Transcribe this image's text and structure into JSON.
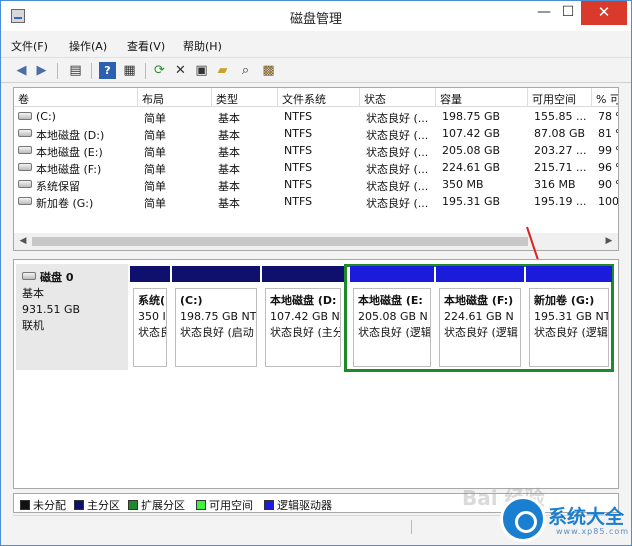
{
  "window": {
    "title": "磁盘管理",
    "controls": {
      "minimize": "—",
      "maximize": "☐",
      "close": "✕"
    }
  },
  "menu": [
    "文件(F)",
    "操作(A)",
    "查看(V)",
    "帮助(H)"
  ],
  "toolbar_icons": [
    "back-arrow-icon",
    "forward-arrow-icon",
    "console-tree-icon",
    "help-icon",
    "properties-icon",
    "refresh-icon",
    "delete-icon",
    "disk-properties-icon",
    "open-folder-icon",
    "search-icon",
    "settings-icon"
  ],
  "volumes": {
    "headers": [
      "卷",
      "布局",
      "类型",
      "文件系统",
      "状态",
      "容量",
      "可用空间",
      "% 可"
    ],
    "rows": [
      [
        "(C:)",
        "简单",
        "基本",
        "NTFS",
        "状态良好 (...",
        "198.75 GB",
        "155.85 ...",
        "78 %"
      ],
      [
        "本地磁盘 (D:)",
        "简单",
        "基本",
        "NTFS",
        "状态良好 (...",
        "107.42 GB",
        "87.08 GB",
        "81 %"
      ],
      [
        "本地磁盘 (E:)",
        "简单",
        "基本",
        "NTFS",
        "状态良好 (...",
        "205.08 GB",
        "203.27 ...",
        "99 %"
      ],
      [
        "本地磁盘 (F:)",
        "简单",
        "基本",
        "NTFS",
        "状态良好 (...",
        "224.61 GB",
        "215.71 ...",
        "96 %"
      ],
      [
        "系统保留",
        "简单",
        "基本",
        "NTFS",
        "状态良好 (...",
        "350 MB",
        "316 MB",
        "90 %"
      ],
      [
        "新加卷 (G:)",
        "简单",
        "基本",
        "NTFS",
        "状态良好 (...",
        "195.31 GB",
        "195.19 ...",
        "100"
      ]
    ],
    "scroll": {
      "left": "◀",
      "right": "▶"
    }
  },
  "disk": {
    "name": "磁盘 0",
    "type": "基本",
    "size": "931.51 GB",
    "state": "联机",
    "partitions": [
      {
        "title": "系统(",
        "size": "350 I",
        "status": "状态良",
        "bar": "#0f0f6e"
      },
      {
        "title": "(C:)",
        "size": "198.75 GB NT",
        "status": "状态良好 (启动",
        "bar": "#0f0f6e"
      },
      {
        "title": "本地磁盘  (D:",
        "size": "107.42 GB NT",
        "status": "状态良好 (主分",
        "bar": "#0f0f6e"
      },
      {
        "title": "本地磁盘  (E:",
        "size": "205.08 GB N",
        "status": "状态良好 (逻辑",
        "bar": "#1b1bdc"
      },
      {
        "title": "本地磁盘  (F:)",
        "size": "224.61 GB N",
        "status": "状态良好 (逻辑",
        "bar": "#1b1bdc"
      },
      {
        "title": "新加卷  (G:)",
        "size": "195.31 GB NT",
        "status": "状态良好 (逻辑",
        "bar": "#1b1bdc"
      }
    ]
  },
  "legend": [
    {
      "label": "未分配",
      "color": "#111111"
    },
    {
      "label": "主分区",
      "color": "#0f0f6e"
    },
    {
      "label": "扩展分区",
      "color": "#1f8a2a"
    },
    {
      "label": "可用空间",
      "color": "#3ff03f"
    },
    {
      "label": "逻辑驱动器",
      "color": "#1b1bdc"
    }
  ],
  "branding": {
    "logo_text": "系统大全",
    "logo_url": "www.xp85.com",
    "watermark": "Bai 经验"
  }
}
